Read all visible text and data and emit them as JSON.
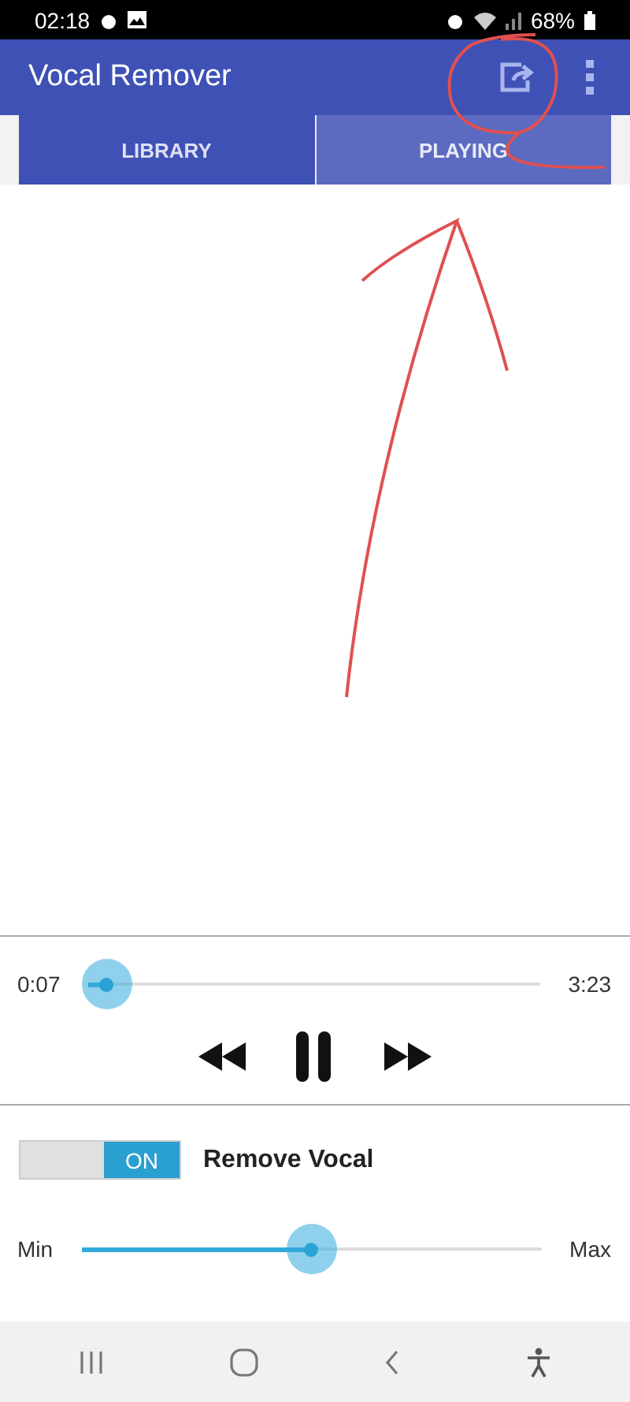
{
  "status_bar": {
    "time": "02:18",
    "battery": "68%"
  },
  "app_bar": {
    "title": "Vocal Remover"
  },
  "tabs": [
    {
      "label": "LIBRARY",
      "selected": false
    },
    {
      "label": "PLAYING",
      "selected": true
    }
  ],
  "player": {
    "elapsed": "0:07",
    "duration": "3:23",
    "level": 0.04,
    "playing": true
  },
  "remove_vocal": {
    "toggle_text": "ON",
    "on": true,
    "label": "Remove Vocal"
  },
  "strength": {
    "min_label": "Min",
    "max_label": "Max",
    "level": 0.5
  }
}
